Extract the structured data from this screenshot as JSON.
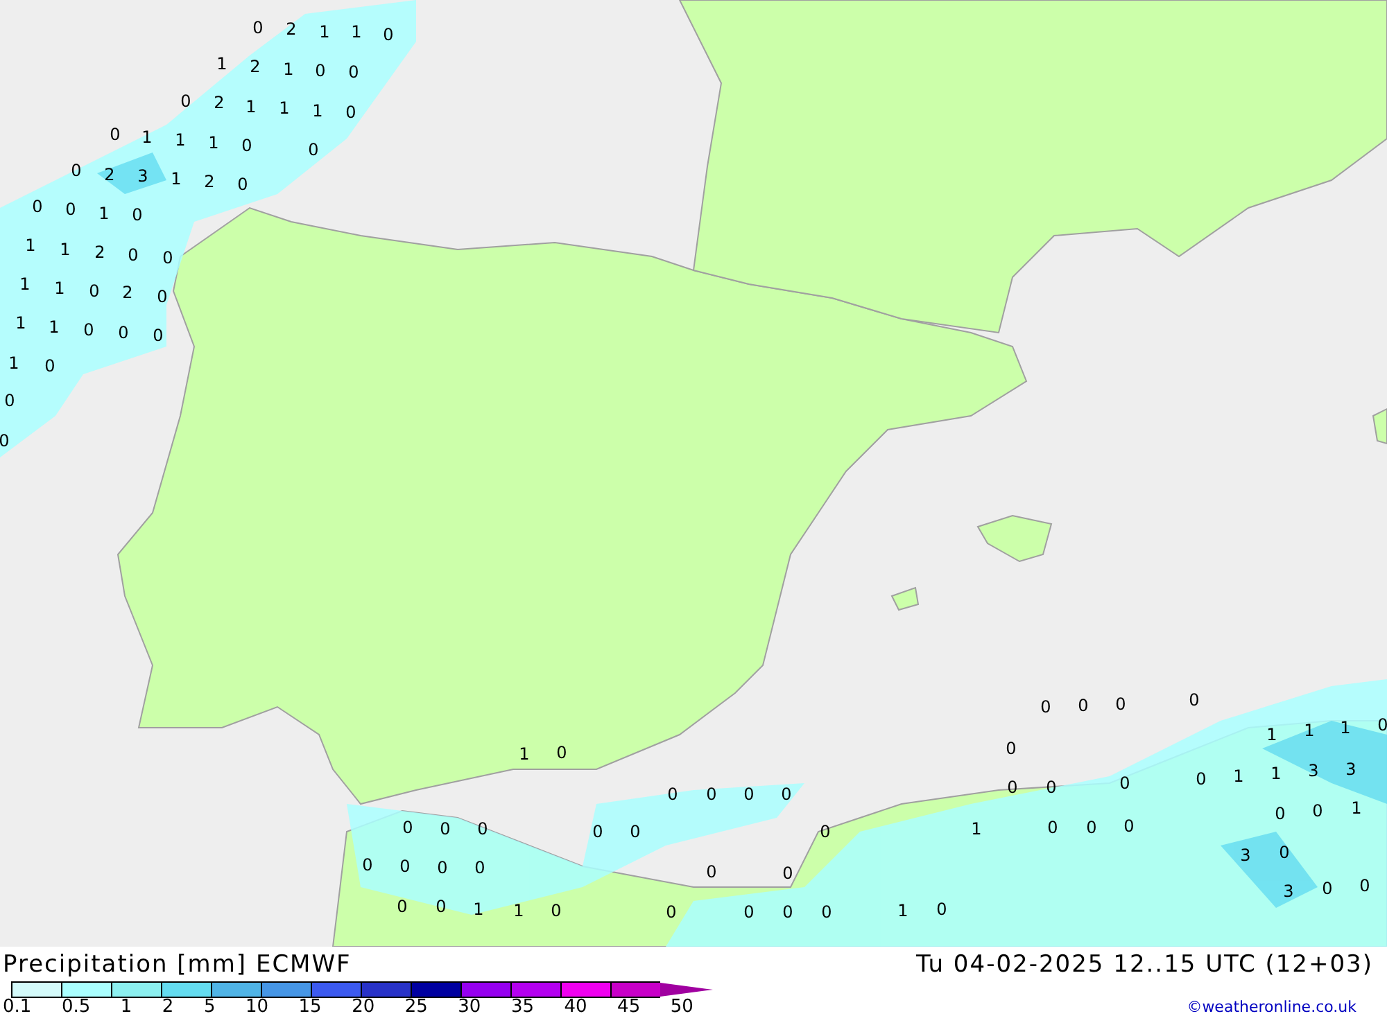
{
  "map": {
    "labels": [
      "0",
      "2",
      "1",
      "1",
      "0",
      "1",
      "2",
      "1",
      "0",
      "0",
      "0",
      "2",
      "1",
      "1",
      "1",
      "0",
      "0",
      "1",
      "1",
      "1",
      "0",
      "0",
      "0",
      "2",
      "3",
      "1",
      "2",
      "0",
      "0",
      "0",
      "1",
      "0",
      "1",
      "1",
      "2",
      "0",
      "0",
      "1",
      "1",
      "0",
      "2",
      "0",
      "1",
      "1",
      "0",
      "0",
      "0",
      "1",
      "0",
      "0",
      "0",
      "1",
      "0",
      "0",
      "0",
      "0",
      "0",
      "0",
      "0",
      "0",
      "0",
      "0",
      "0",
      "0",
      "0",
      "0",
      "0",
      "0",
      "0",
      "0",
      "0",
      "1",
      "1",
      "0",
      "0",
      "0",
      "0",
      "0",
      "0",
      "0",
      "0",
      "0",
      "0",
      "1",
      "1",
      "1",
      "0",
      "0",
      "0",
      "0",
      "0",
      "1",
      "1",
      "3",
      "3",
      "0",
      "0",
      "1",
      "1",
      "0",
      "0",
      "0",
      "3",
      "0",
      "3",
      "0",
      "0",
      "1",
      "0"
    ]
  },
  "legend": {
    "title": "Precipitation [mm] ECMWF",
    "valid_time": "Tu 04-02-2025 12..15 UTC (12+03)",
    "credit": "©weatheronline.co.uk",
    "swatches": [
      {
        "color": "#d4fafa"
      },
      {
        "color": "#aaffff"
      },
      {
        "color": "#8cf0f0"
      },
      {
        "color": "#64dcf0"
      },
      {
        "color": "#50b4e6"
      },
      {
        "color": "#4696e6"
      },
      {
        "color": "#3c5af0"
      },
      {
        "color": "#2832c8"
      },
      {
        "color": "#0000a0"
      },
      {
        "color": "#9600f0"
      },
      {
        "color": "#b400f0"
      },
      {
        "color": "#f000f0"
      },
      {
        "color": "#c800c8"
      }
    ],
    "ticks": [
      "0.1",
      "0.5",
      "1",
      "2",
      "5",
      "10",
      "15",
      "20",
      "25",
      "30",
      "35",
      "40",
      "45",
      "50"
    ]
  }
}
